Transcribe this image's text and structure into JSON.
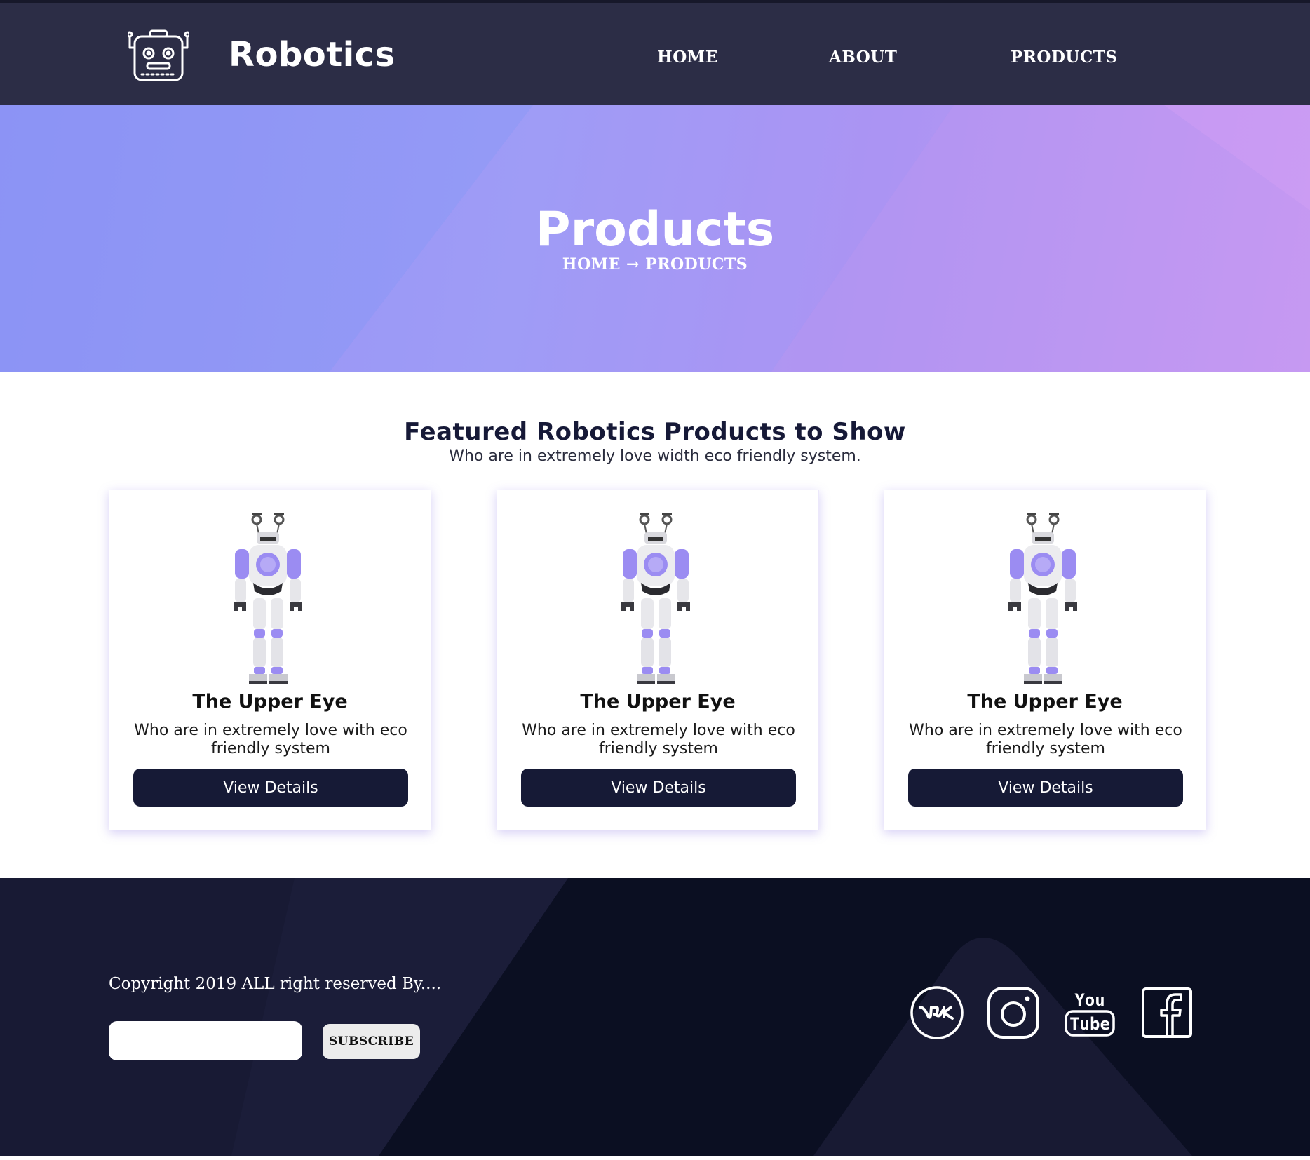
{
  "header": {
    "brand": "Robotics",
    "nav": [
      {
        "label": "HOME"
      },
      {
        "label": "ABOUT"
      },
      {
        "label": "PRODUCTS"
      }
    ]
  },
  "hero": {
    "title": "Products",
    "breadcrumb": {
      "home": "HOME",
      "separator": "→",
      "current": "PRODUCTS"
    }
  },
  "featured": {
    "title": "Featured Robotics Products to Show",
    "subtitle": "Who are in extremely love width eco friendly system.",
    "cards": [
      {
        "title": "The Upper Eye",
        "description": "Who are in extremely love with eco friendly system",
        "button": "View Details"
      },
      {
        "title": "The Upper Eye",
        "description": "Who are in extremely love with eco friendly system",
        "button": "View Details"
      },
      {
        "title": "The Upper Eye",
        "description": "Who are in extremely love with eco friendly system",
        "button": "View Details"
      }
    ]
  },
  "footer": {
    "copyright": "Copyright 2019 ALL right reserved By....",
    "subscribe": {
      "placeholder": "",
      "button": "SUBSCRIBE"
    },
    "social": {
      "vk_icon": "vk-icon",
      "instagram_icon": "instagram-icon",
      "youtube_icon": "youtube-icon",
      "youtube_text_top": "You",
      "youtube_text_bottom": "Tube",
      "facebook_icon": "facebook-icon"
    }
  },
  "colors": {
    "header_bg": "#2c2d46",
    "hero_start": "#8a91f4",
    "hero_end": "#c698f3",
    "button_bg": "#161a36",
    "footer_bg": "#0b0f22",
    "accent_purple": "#9b8cf2"
  }
}
